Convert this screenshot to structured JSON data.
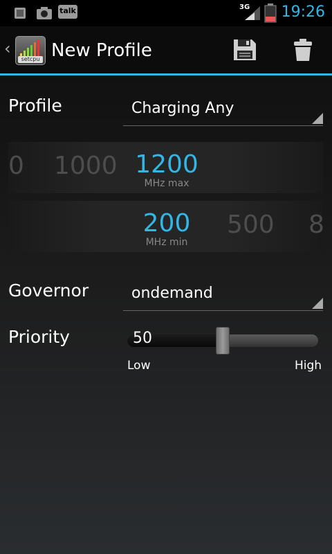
{
  "status_bar": {
    "left_icons": [
      "sdcard-icon",
      "camera-icon",
      "talk-icon"
    ],
    "talk_label": "talk",
    "network_label": "3G",
    "time": "19:26"
  },
  "action_bar": {
    "app_icon_label": "setcpu",
    "title": "New Profile",
    "save_icon": "save-icon",
    "delete_icon": "trash-icon"
  },
  "profile": {
    "label": "Profile",
    "value": "Charging Any"
  },
  "max_wheel": {
    "values": [
      "0",
      "1000",
      "1200"
    ],
    "selected": "1200",
    "unit": "MHz max"
  },
  "min_wheel": {
    "values": [
      "200",
      "500",
      "8"
    ],
    "selected": "200",
    "unit": "MHz min"
  },
  "governor": {
    "label": "Governor",
    "value": "ondemand"
  },
  "priority": {
    "label": "Priority",
    "value": "50",
    "level": 0.5,
    "low_label": "Low",
    "high_label": "High"
  },
  "colors": {
    "accent": "#33b5e5"
  }
}
